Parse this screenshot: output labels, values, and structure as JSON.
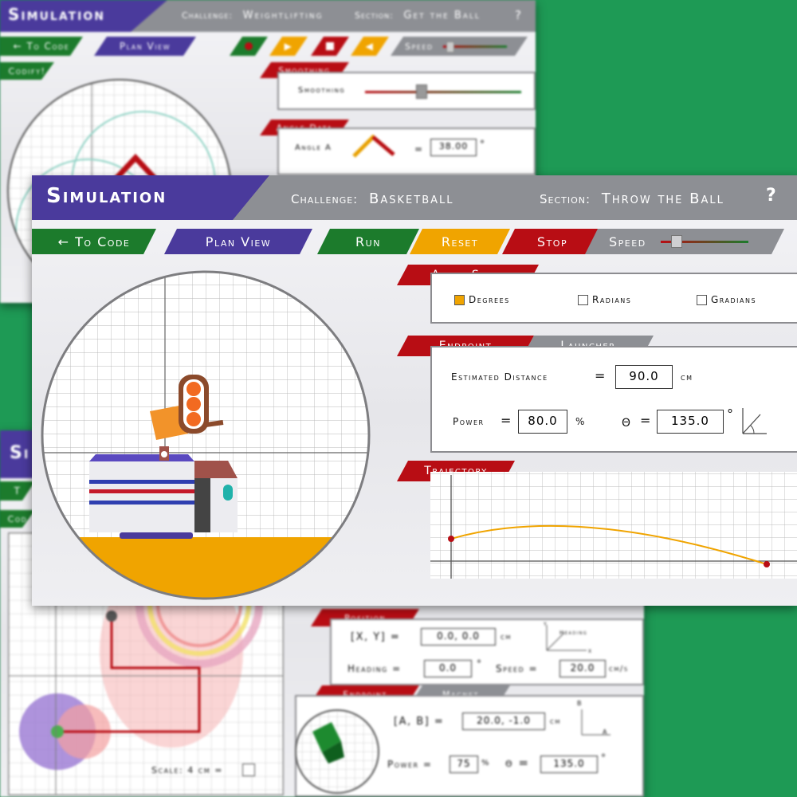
{
  "back_top": {
    "title": "Simulation",
    "challenge_label": "Challenge:",
    "challenge_value": "Weightlifting",
    "section_label": "Section:",
    "section_value": "Get the Ball",
    "help": "?",
    "to_code": "← To Code",
    "plan_view": "Plan View",
    "codify": "Codify!",
    "speed_label": "Speed",
    "smoothing_tab": "Smoothing",
    "smoothing_label": "Smoothing",
    "angle_tab": "Angle Data",
    "angle_a_label": "Angle A",
    "angle_a_eq": "=",
    "angle_a_value": "38.00",
    "angle_a_unit": "°"
  },
  "back_bottom": {
    "title_partial": "Si",
    "to_partial": "T",
    "codify_partial": "Cod",
    "scale_label": "Scale: 4 cm =",
    "position_tab": "Position",
    "xy_label": "[X, Y] =",
    "xy_value": "0.0,  0.0",
    "xy_unit": "cm",
    "heading_label": "Heading =",
    "heading_value": "0.0",
    "heading_unit": "°",
    "speed_label": "Speed =",
    "speed_value": "20.0",
    "speed_unit": "cm/s",
    "endpoint_tab": "Endpoint",
    "magnet_tab": "Magnet",
    "ab_label": "[A, B] =",
    "ab_value": "20.0, -1.0",
    "ab_unit": "cm",
    "power_label": "Power =",
    "power_value": "75",
    "power_unit": "%",
    "theta_label": "θ =",
    "theta_value": "135.0",
    "theta_unit": "°",
    "heading_axis": "Heading",
    "x_axis": "x",
    "y_axis": "y",
    "a_axis": "A",
    "b_axis": "B"
  },
  "main": {
    "title": "Simulation",
    "challenge_label": "Challenge:",
    "challenge_value": "Basketball",
    "section_label": "Section:",
    "section_value": "Throw the Ball",
    "help": "?",
    "toolbar": {
      "to_code": "← To Code",
      "plan_view": "Plan View",
      "run": "Run",
      "reset": "Reset",
      "stop": "Stop",
      "speed": "Speed"
    },
    "speed_level": 0.12,
    "angle_style": {
      "tab": "Angle Style",
      "options": [
        "Degrees",
        "Radians",
        "Gradians"
      ],
      "selected": "Degrees"
    },
    "endpoint": {
      "tab": "Endpoint",
      "tab2": "Launcher",
      "est_label": "Estimated Distance",
      "eq": "=",
      "est_value": "90.0",
      "est_unit": "cm",
      "power_label": "Power",
      "power_value": "80.0",
      "power_unit": "%",
      "theta_label": "θ",
      "theta_value": "135.0",
      "theta_unit": "°"
    },
    "trajectory": {
      "tab": "Trajectory"
    },
    "colors": {
      "title_purple": "#4a3a9c",
      "green": "#1c7b2c",
      "orange": "#f0a400",
      "red": "#b80d14",
      "gray": "#8d8f94"
    }
  }
}
